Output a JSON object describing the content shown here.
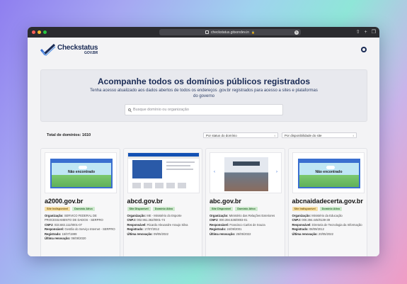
{
  "browser": {
    "url": "checkstatus.gitsondev.in",
    "dots": [
      "#ff5f57",
      "#febc2e",
      "#28c840"
    ]
  },
  "header": {
    "logo_title": "Checkstatus",
    "logo_sub": "GOV.BR",
    "github_icon": "github-icon"
  },
  "hero": {
    "title": "Acompanhe todos os domínios públicos registrados",
    "subtitle": "Tenha acesso atualizado aos dados abertos de todos os endereços .gov.br registrados para acesso a sites e plataformas do governo",
    "search_placeholder": "Busque domínio ou organização"
  },
  "filters": {
    "total": "Total de domínios: 1610",
    "status_select": "Por status do domínio",
    "availability_select": "Por disponibilidade do site"
  },
  "labels": {
    "org": "Organização:",
    "cnpj": "CNPJ:",
    "resp": "Responsável:",
    "reg": "Registrado:",
    "renew": "Última renovação:"
  },
  "cards": [
    {
      "domain": "a2000.gov.br",
      "thumb": "Não encontrado",
      "badges": [
        "Site Indisponível",
        "Domínio Ativo"
      ],
      "org": "SERVICO FEDERAL DE PROCESSAMENTO DE DADOS - SERPRO",
      "cnpj": "033.683.111/0001-07",
      "resp": "Gestão do Serviço Internet - SERPRO",
      "reg": "15/07/1999",
      "renew": "06/08/2020"
    },
    {
      "domain": "abcd.gov.br",
      "thumb": "",
      "badges": [
        "Site Disponível",
        "Domínio Ativo"
      ],
      "org": "ME - Ministério do Esporte",
      "cnpj": "002.961.362/0001-74",
      "resp": "Ricardo Alexandre Araujo Silva",
      "reg": "17/07/2012",
      "renew": "09/05/2022"
    },
    {
      "domain": "abc.gov.br",
      "thumb": "",
      "badges": [
        "Site Disponível",
        "Domínio Ativo"
      ],
      "org": "Ministério das Relações Exteriores",
      "cnpj": "000.394.536/0003-01",
      "resp": "Francisco Carlos de Souza",
      "reg": "24/09/2001",
      "renew": "25/05/2022"
    },
    {
      "domain": "abcnaidadecerta.gov.br",
      "thumb": "Não encontrado",
      "badges": [
        "Site Indisponível",
        "Domínio Ativo"
      ],
      "org": "Ministério da Educação",
      "cnpj": "000.394.445/0139-39",
      "resp": "Diretoria de Tecnologia da Informação",
      "reg": "08/09/2012",
      "renew": "20/05/2022"
    }
  ]
}
